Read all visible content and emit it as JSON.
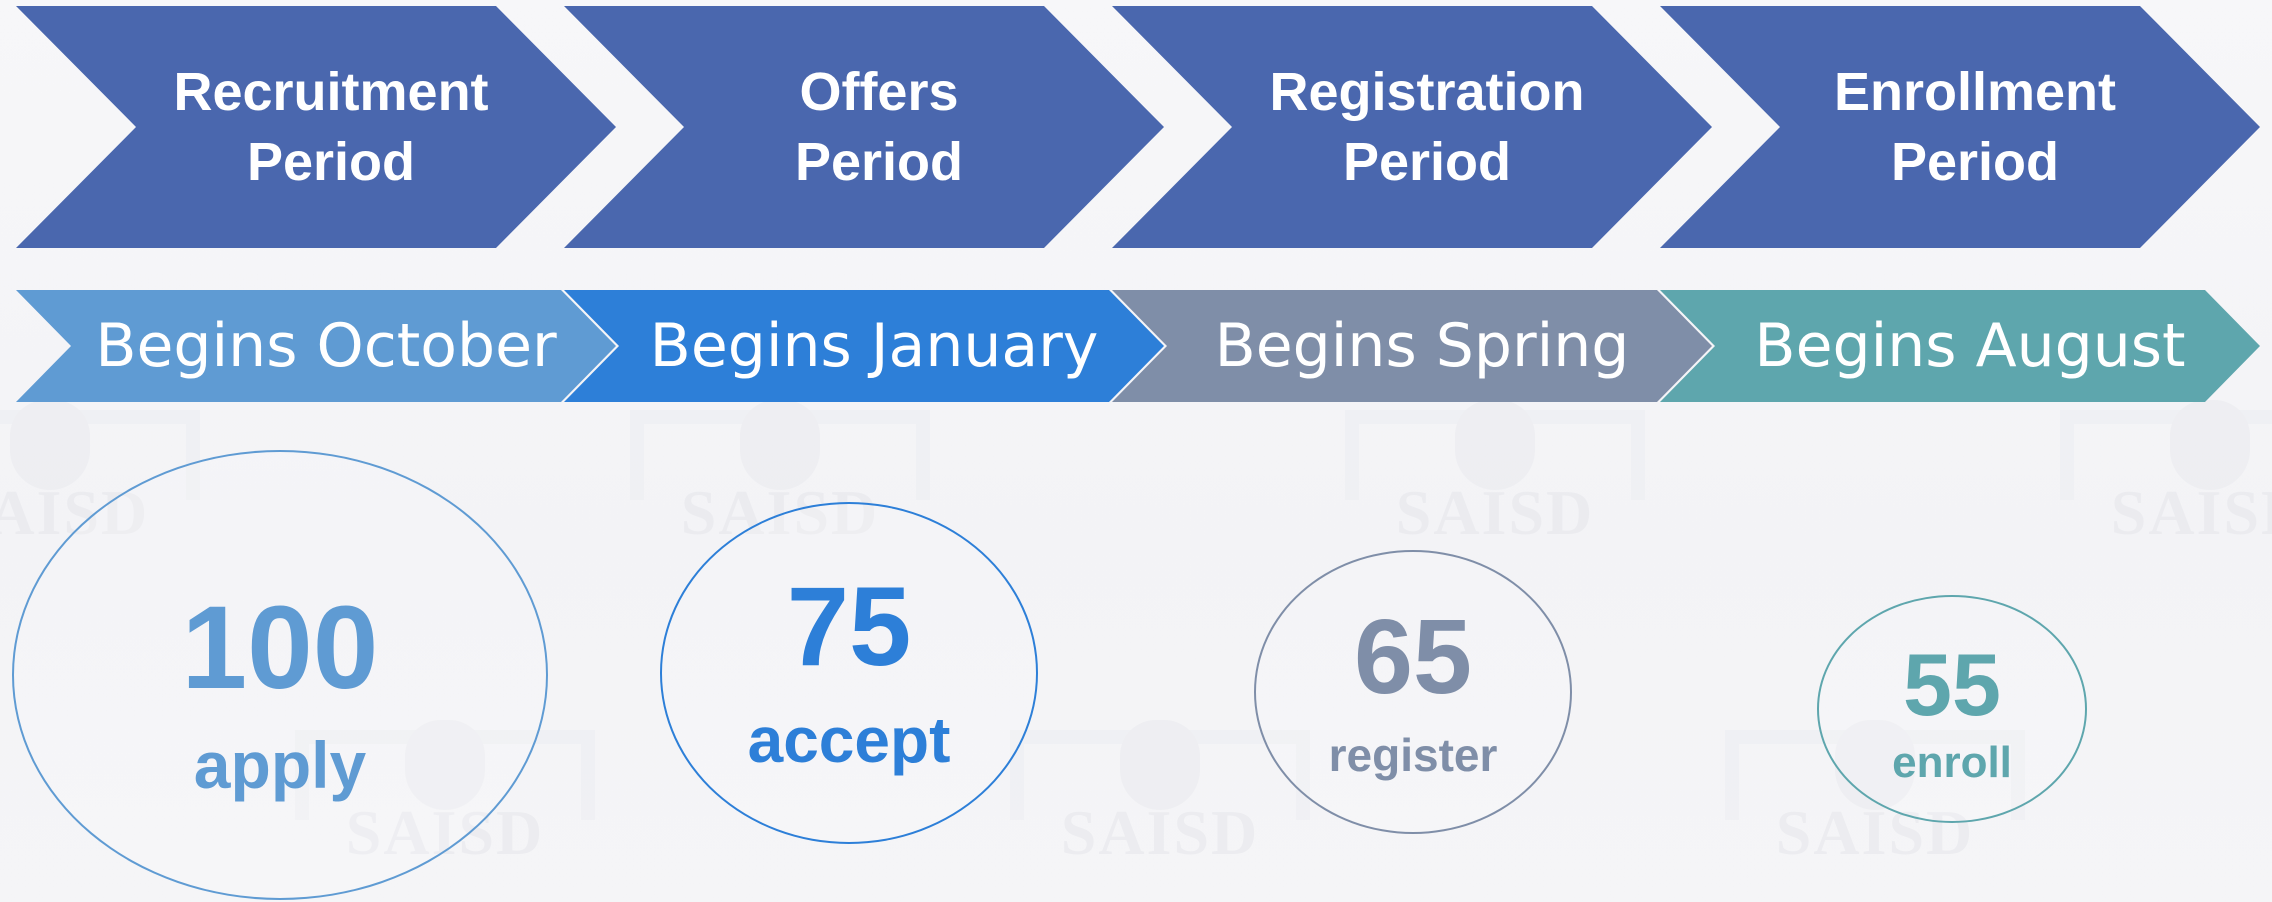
{
  "stages": [
    {
      "period": "Recruitment\nPeriod",
      "begins": "Begins October",
      "count": "100",
      "action": "apply"
    },
    {
      "period": "Offers\nPeriod",
      "begins": "Begins January",
      "count": "75",
      "action": "accept"
    },
    {
      "period": "Registration\nPeriod",
      "begins": "Begins Spring",
      "count": "65",
      "action": "register"
    },
    {
      "period": "Enrollment\nPeriod",
      "begins": "Begins August",
      "count": "55",
      "action": "enroll"
    }
  ],
  "watermark": "SAISD",
  "colors": {
    "period_chevron": "#4a67ae",
    "stage_1": "#5f9bd3",
    "stage_2": "#2d7fd8",
    "stage_3": "#7f8ea8",
    "stage_4": "#5ea6ad"
  }
}
